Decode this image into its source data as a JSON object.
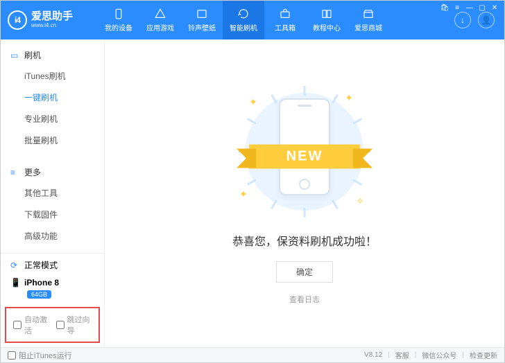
{
  "brand": {
    "logo": "i4",
    "name": "爱思助手",
    "url": "www.i4.cn"
  },
  "nav": [
    {
      "label": "我的设备"
    },
    {
      "label": "应用游戏"
    },
    {
      "label": "铃声壁纸"
    },
    {
      "label": "智能刷机"
    },
    {
      "label": "工具箱"
    },
    {
      "label": "教程中心"
    },
    {
      "label": "爱思商城"
    }
  ],
  "sidebar": {
    "flash": {
      "title": "刷机",
      "items": [
        "iTunes刷机",
        "一键刷机",
        "专业刷机",
        "批量刷机"
      ]
    },
    "more": {
      "title": "更多",
      "items": [
        "其他工具",
        "下载固件",
        "高级功能"
      ]
    }
  },
  "device": {
    "mode": "正常模式",
    "name": "iPhone 8",
    "storage": "64GB"
  },
  "options": {
    "auto_activate": "自动激活",
    "skip_wizard": "跳过向导"
  },
  "main": {
    "ribbon": "NEW",
    "success": "恭喜您，保资料刷机成功啦！",
    "ok": "确定",
    "log": "查看日志"
  },
  "footer": {
    "block_itunes": "阻止iTunes运行",
    "version": "V8.12",
    "support": "客服",
    "wechat": "微信公众号",
    "update": "检查更新"
  }
}
